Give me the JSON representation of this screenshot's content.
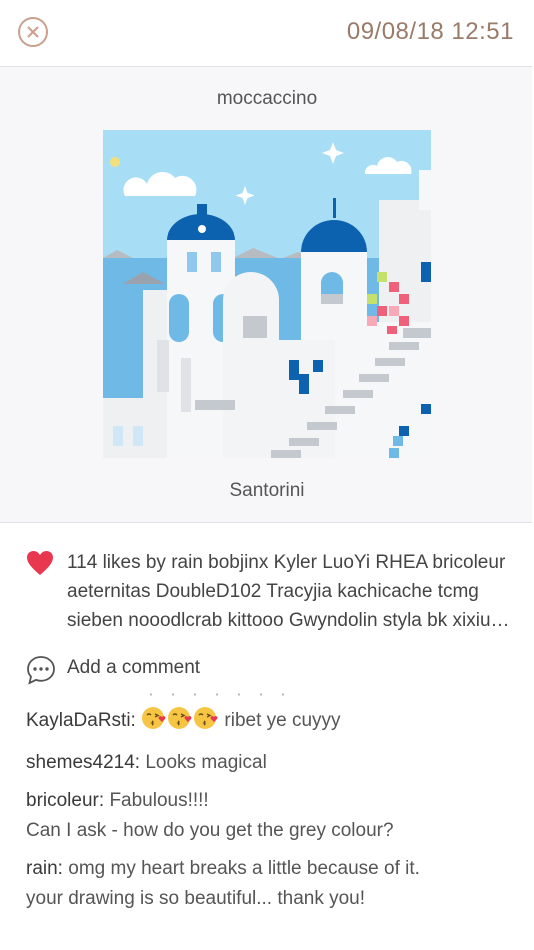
{
  "header": {
    "timestamp": "09/08/18 12:51"
  },
  "post": {
    "author": "moccaccino",
    "artwork_title": "Santorini",
    "likes_text": "114 likes by rain bobjinx Kyler LuoYi RHEA bricoleur aeternitas DoubleD102 Tracyjia kachicache tcmg sieben nooodlcrab kittooo Gwyndolin styla bk xixiu…",
    "add_comment_label": "Add a comment"
  },
  "comments": [
    {
      "user": "KaylaDaRsti:",
      "emoji": "kissing-face-heart",
      "emoji_count": 3,
      "text": "ribet ye cuyyy"
    },
    {
      "user": "shemes4214:",
      "text": "Looks magical"
    },
    {
      "user": "bricoleur:",
      "text": "Fabulous!!!!",
      "text_line2": "Can I ask - how do you get the grey colour?"
    },
    {
      "user": "rain:",
      "text": "omg my heart breaks a little because of it.",
      "text_line2": "your drawing is so beautiful... thank you!"
    }
  ],
  "colors": {
    "accent": "#c9a08d",
    "like": "#e8384f",
    "sky": "#a8def5",
    "sea": "#6fb9e6",
    "dome": "#0d62b0"
  },
  "icons": {
    "close": "close-icon",
    "like": "heart-icon",
    "comment": "comment-bubble-icon"
  }
}
